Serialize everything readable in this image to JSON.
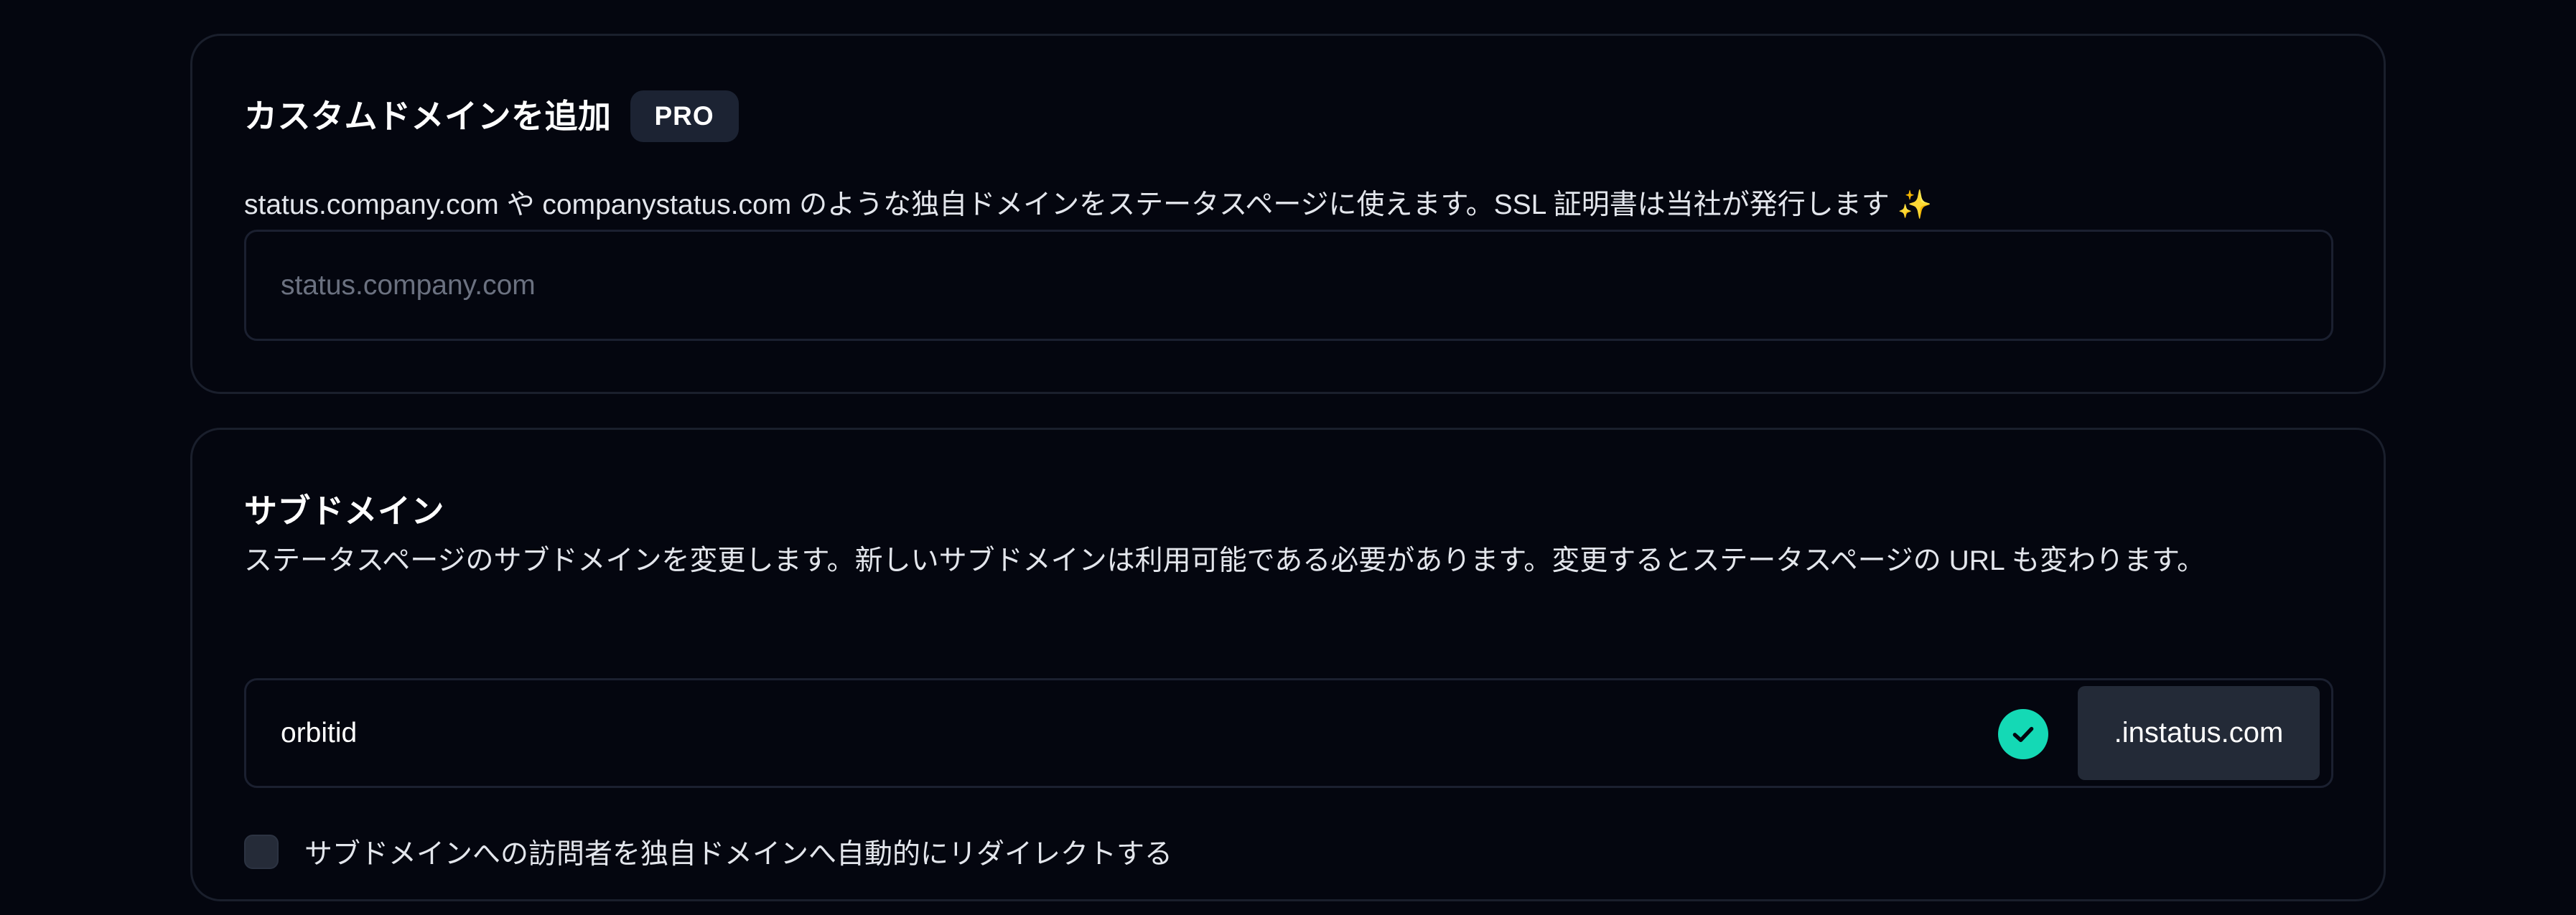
{
  "custom_domain": {
    "title": "カスタムドメインを追加",
    "badge": "PRO",
    "description": "status.company.com や companystatus.com のような独自ドメインをステータスページに使えます。SSL 証明書は当社が発行します ✨",
    "input_placeholder": "status.company.com",
    "input_value": ""
  },
  "subdomain": {
    "title": "サブドメイン",
    "description": "ステータスページのサブドメインを変更します。新しいサブドメインは利用可能である必要があります。変更するとステータスページの URL も変わります。",
    "input_value": "orbitid",
    "availability_icon": "check-circle-icon",
    "suffix": ".instatus.com",
    "redirect_checkbox_checked": false,
    "redirect_label": "サブドメインへの訪問者を独自ドメインへ自動的にリダイレクトする"
  },
  "colors": {
    "background": "#04060f",
    "card_border": "#1a1f2c",
    "badge_bg": "#1c2333",
    "available_green": "#14d9b5",
    "suffix_bg": "#232a37"
  }
}
